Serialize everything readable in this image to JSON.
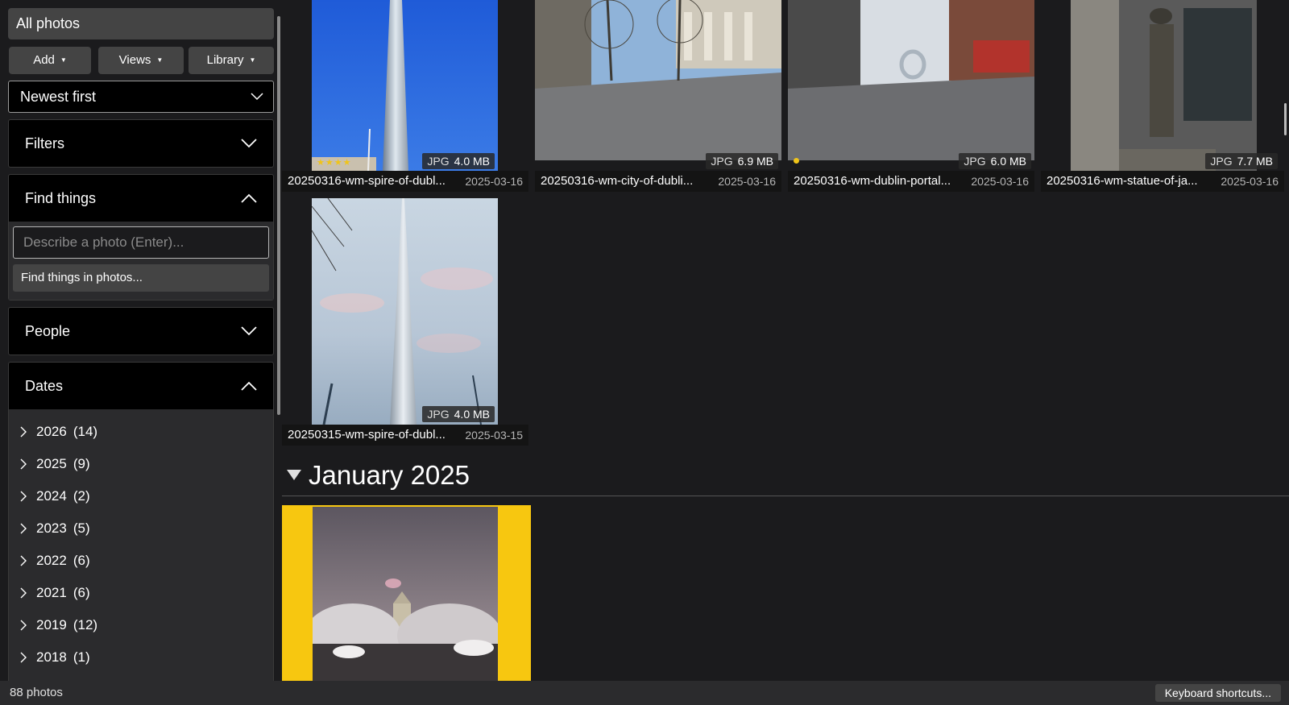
{
  "sidebar": {
    "all_photos": "All photos",
    "toolbar": {
      "add": "Add",
      "views": "Views",
      "library": "Library"
    },
    "sort": {
      "selected": "Newest first"
    },
    "panels": {
      "filters": "Filters",
      "find_things": "Find things",
      "people": "People",
      "dates": "Dates"
    },
    "find": {
      "placeholder": "Describe a photo (Enter)...",
      "button": "Find things in photos..."
    },
    "dates": [
      {
        "year": "2026",
        "count": "(14)"
      },
      {
        "year": "2025",
        "count": "(9)"
      },
      {
        "year": "2024",
        "count": "(2)"
      },
      {
        "year": "2023",
        "count": "(5)"
      },
      {
        "year": "2022",
        "count": "(6)"
      },
      {
        "year": "2021",
        "count": "(6)"
      },
      {
        "year": "2019",
        "count": "(12)"
      },
      {
        "year": "2018",
        "count": "(1)"
      }
    ]
  },
  "photos": [
    {
      "name": "20250316-wm-spire-of-dubl...",
      "date": "2025-03-16",
      "type": "JPG",
      "size": "4.0 MB",
      "rating": "★★★★"
    },
    {
      "name": "20250316-wm-city-of-dubli...",
      "date": "2025-03-16",
      "type": "JPG",
      "size": "6.9 MB"
    },
    {
      "name": "20250316-wm-dublin-portal...",
      "date": "2025-03-16",
      "type": "JPG",
      "size": "6.0 MB"
    },
    {
      "name": "20250316-wm-statue-of-ja...",
      "date": "2025-03-16",
      "type": "JPG",
      "size": "7.7 MB"
    },
    {
      "name": "20250315-wm-spire-of-dubl...",
      "date": "2025-03-15",
      "type": "JPG",
      "size": "4.0 MB"
    }
  ],
  "month_group": {
    "label": "January 2025"
  },
  "colors": {
    "selection": "#f7c710",
    "rating": "#f0c419"
  },
  "status": {
    "count": "88 photos",
    "shortcuts": "Keyboard shortcuts..."
  }
}
